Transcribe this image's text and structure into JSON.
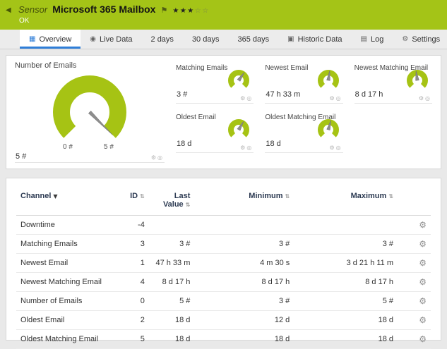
{
  "colors": {
    "header_bg": "#a4c417",
    "gauge_green": "#a6c314",
    "active_tab_underline": "#2f7ed8"
  },
  "icons": {
    "back": "◀",
    "flag": "⚑",
    "star_filled": "★",
    "star_empty": "☆",
    "overview": "▦",
    "live": "◉",
    "historic": "▣",
    "log": "▤",
    "settings": "⚙",
    "sort_active": "▼",
    "sort_inactive": "⇅",
    "gauge_settings": "⚙",
    "gauge_pin": "◎",
    "channel_edit": "⚙"
  },
  "header": {
    "kind": "Sensor",
    "title": "Microsoft 365 Mailbox",
    "status": "OK",
    "rating": {
      "filled": 3,
      "total": 5
    }
  },
  "tabs": [
    {
      "label": "Overview",
      "icon": "overview",
      "active": true
    },
    {
      "label": "Live Data",
      "icon": "live"
    },
    {
      "label": "2 days"
    },
    {
      "label": "30 days"
    },
    {
      "label": "365 days"
    },
    {
      "label": "Historic Data",
      "icon": "historic"
    },
    {
      "label": "Log",
      "icon": "log"
    },
    {
      "label": "Settings",
      "icon": "settings"
    }
  ],
  "overview": {
    "main_gauge": {
      "title": "Number of Emails",
      "value": "5 #",
      "scale_min": "0 #",
      "scale_max": "5 #",
      "needle_deg": 45
    },
    "small_gauges": [
      {
        "title": "Matching Emails",
        "value": "3 #",
        "needle_deg": 305
      },
      {
        "title": "Newest Email",
        "value": "47 h 33 m",
        "needle_deg": 278
      },
      {
        "title": "Newest Matching Email",
        "value": "8 d 17 h",
        "needle_deg": 262
      },
      {
        "title": "Oldest Email",
        "value": "18 d",
        "needle_deg": 300
      },
      {
        "title": "Oldest Matching Email",
        "value": "18 d",
        "needle_deg": 285
      }
    ]
  },
  "table": {
    "columns": [
      {
        "label": "Channel",
        "sort": "active"
      },
      {
        "label": "ID",
        "sort": "inactive"
      },
      {
        "label": "Last Value",
        "sort": "inactive"
      },
      {
        "label": "Minimum",
        "sort": "inactive"
      },
      {
        "label": "Maximum",
        "sort": "inactive"
      }
    ],
    "rows": [
      {
        "channel": "Downtime",
        "id": "-4",
        "last_value": "",
        "minimum": "",
        "maximum": ""
      },
      {
        "channel": "Matching Emails",
        "id": "3",
        "last_value": "3 #",
        "minimum": "3 #",
        "maximum": "3 #"
      },
      {
        "channel": "Newest Email",
        "id": "1",
        "last_value": "47 h 33 m",
        "minimum": "4 m 30 s",
        "maximum": "3 d 21 h 11 m"
      },
      {
        "channel": "Newest Matching Email",
        "id": "4",
        "last_value": "8 d 17 h",
        "minimum": "8 d 17 h",
        "maximum": "8 d 17 h"
      },
      {
        "channel": "Number of Emails",
        "id": "0",
        "last_value": "5 #",
        "minimum": "3 #",
        "maximum": "5 #"
      },
      {
        "channel": "Oldest Email",
        "id": "2",
        "last_value": "18 d",
        "minimum": "12 d",
        "maximum": "18 d"
      },
      {
        "channel": "Oldest Matching Email",
        "id": "5",
        "last_value": "18 d",
        "minimum": "18 d",
        "maximum": "18 d"
      }
    ]
  }
}
